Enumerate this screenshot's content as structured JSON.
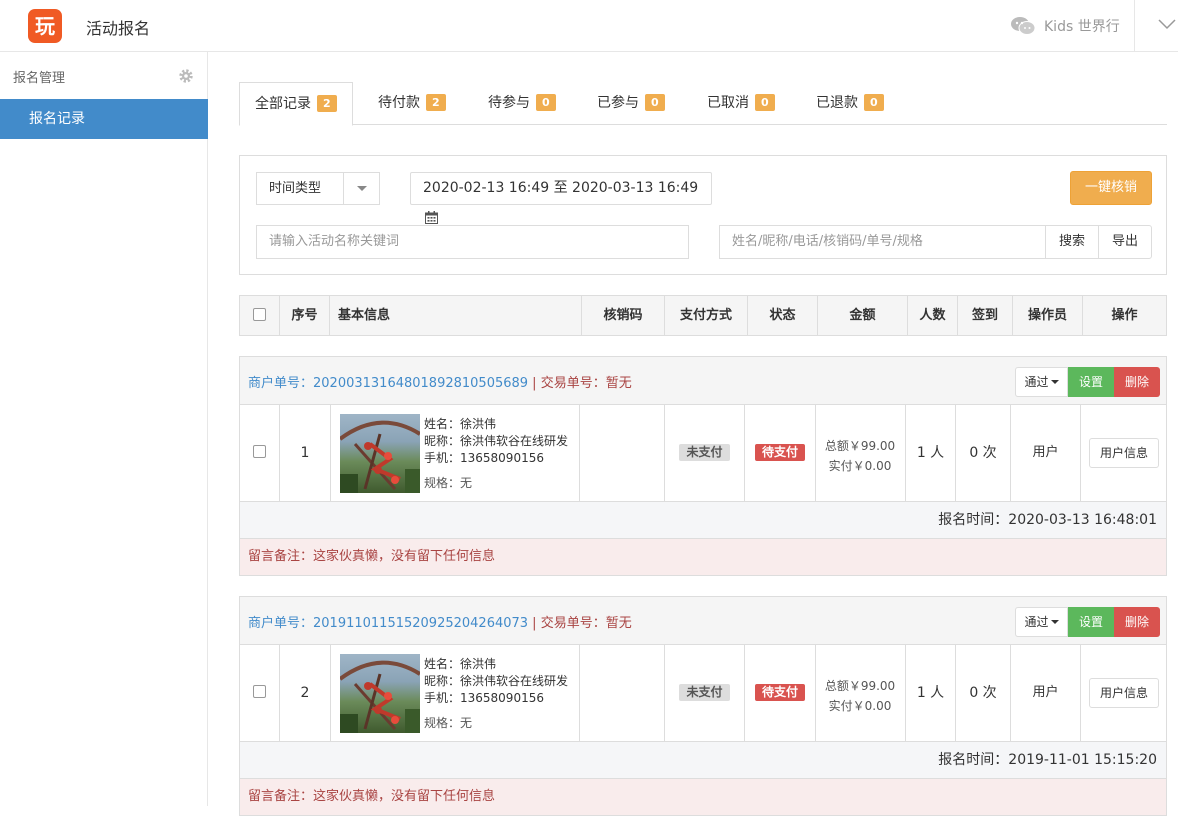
{
  "header": {
    "logo_text": "玩",
    "app_title": "活动报名",
    "user_name": "Kids 世界行"
  },
  "sidebar": {
    "section_title": "报名管理",
    "items": [
      {
        "label": "报名记录"
      }
    ]
  },
  "tabs": [
    {
      "label": "全部记录",
      "count": "2"
    },
    {
      "label": "待付款",
      "count": "2"
    },
    {
      "label": "待参与",
      "count": "0"
    },
    {
      "label": "已参与",
      "count": "0"
    },
    {
      "label": "已取消",
      "count": "0"
    },
    {
      "label": "已退款",
      "count": "0"
    }
  ],
  "filters": {
    "time_type": "时间类型",
    "date_range": "2020-02-13 16:49 至 2020-03-13 16:49",
    "verify_all_button": "一键核销",
    "keyword_placeholder": "请输入活动名称关键词",
    "search_placeholder": "姓名/昵称/电话/核销码/单号/规格",
    "search_button": "搜索",
    "export_button": "导出"
  },
  "table": {
    "columns": [
      "序号",
      "基本信息",
      "核销码",
      "支付方式",
      "状态",
      "金额",
      "人数",
      "签到",
      "操作员",
      "操作"
    ]
  },
  "orders": [
    {
      "merchant_no": "商户单号：20200313164801892810505689",
      "trade_no": "交易单号：暂无",
      "op_pass": "通过",
      "op_set": "设置",
      "op_delete": "删除",
      "index": "1",
      "name": "姓名：徐洪伟",
      "nickname": "昵称：徐洪伟软谷在线研发",
      "phone": "手机：13658090156",
      "spec": "规格：无",
      "payment_status": "未支付",
      "status": "待支付",
      "total": "总额￥99.00",
      "paid": "实付￥0.00",
      "people": "1 人",
      "signin": "0 次",
      "operator": "用户",
      "user_info_button": "用户信息",
      "signup_time": "报名时间：2020-03-13 16:48:01",
      "remark": "留言备注：这家伙真懒，没有留下任何信息"
    },
    {
      "merchant_no": "商户单号：20191101151520925204264073",
      "trade_no": "交易单号：暂无",
      "op_pass": "通过",
      "op_set": "设置",
      "op_delete": "删除",
      "index": "2",
      "name": "姓名：徐洪伟",
      "nickname": "昵称：徐洪伟软谷在线研发",
      "phone": "手机：13658090156",
      "spec": "规格：无",
      "payment_status": "未支付",
      "status": "待支付",
      "total": "总额￥99.00",
      "paid": "实付￥0.00",
      "people": "1 人",
      "signin": "0 次",
      "operator": "用户",
      "user_info_button": "用户信息",
      "signup_time": "报名时间：2019-11-01 15:15:20",
      "remark": "留言备注：这家伙真懒，没有留下任何信息"
    }
  ]
}
